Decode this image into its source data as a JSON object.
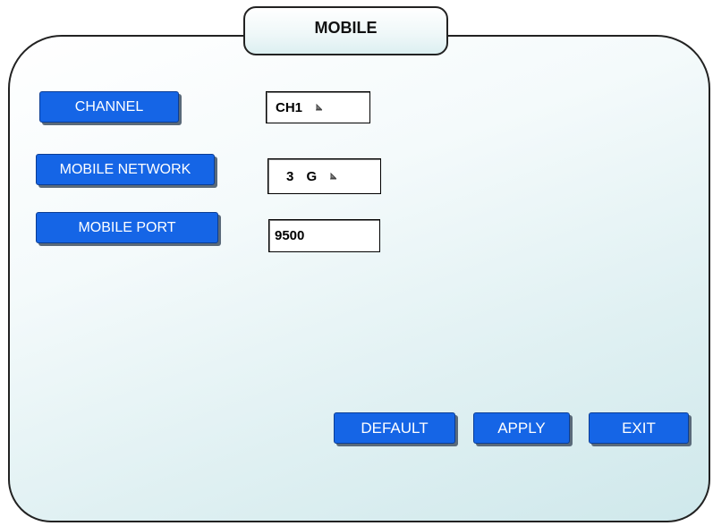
{
  "title": "MOBILE",
  "settings": {
    "channel_label": "CHANNEL",
    "channel_value": "CH1",
    "network_label": "MOBILE NETWORK",
    "network_value": "3 G",
    "port_label": "MOBILE PORT",
    "port_value": "9500"
  },
  "actions": {
    "default_label": "DEFAULT",
    "apply_label": "APPLY",
    "exit_label": "EXIT"
  },
  "colors": {
    "button_blue": "#1565e6",
    "panel_gradient_end": "#cfe8eb"
  },
  "icons": {
    "dropdown": "dropdown-arrow-icon"
  }
}
